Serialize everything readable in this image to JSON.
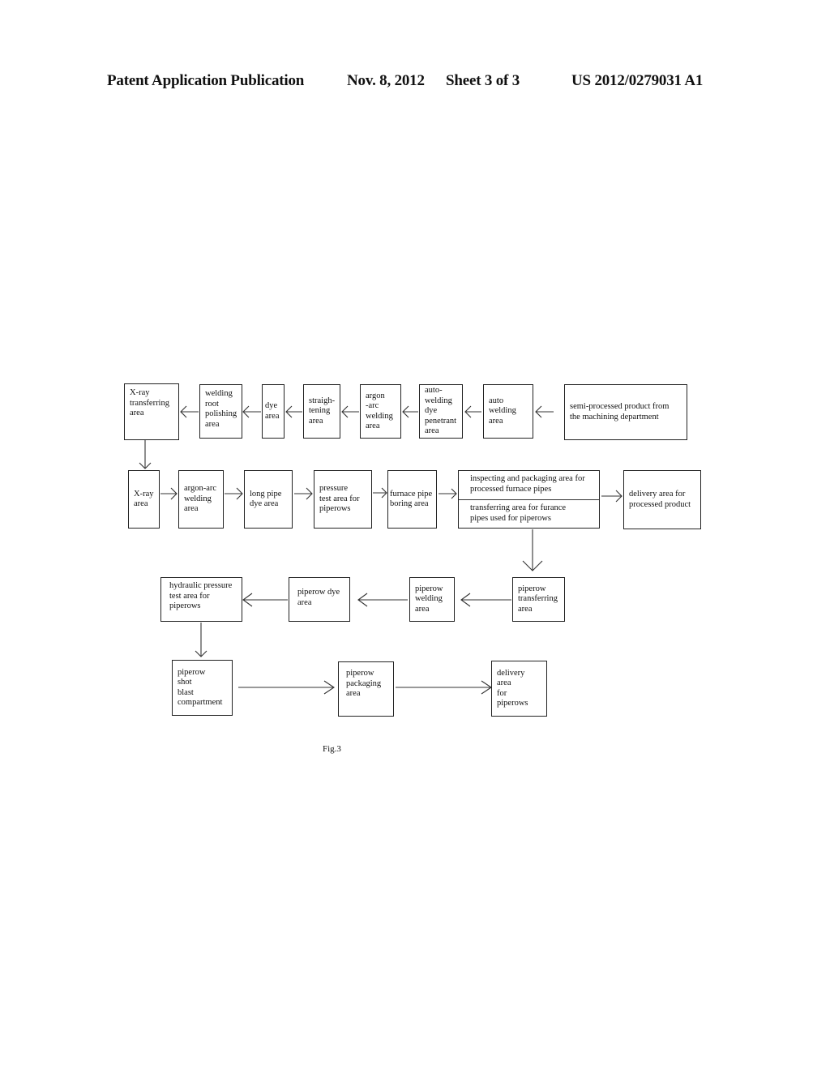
{
  "header": {
    "publication": "Patent Application Publication",
    "date": "Nov. 8, 2012",
    "sheet": "Sheet 3 of 3",
    "number": "US 2012/0279031 A1"
  },
  "figure_label": "Fig.3",
  "row1": [
    {
      "id": "xray-transferring",
      "label": "X-ray\ntransferring\narea"
    },
    {
      "id": "welding-root-polishing",
      "label": "welding\nroot\npolishing\narea"
    },
    {
      "id": "dye",
      "label": "dye\narea"
    },
    {
      "id": "straightening",
      "label": "straigh-\ntening\narea"
    },
    {
      "id": "argon-arc-welding-1",
      "label": "argon\n-arc\nwelding\narea"
    },
    {
      "id": "auto-welding-dye-penetrant",
      "label": "auto-\nwelding\ndye\npenetrant\narea"
    },
    {
      "id": "auto-welding",
      "label": "auto\nwelding\narea"
    },
    {
      "id": "semi-processed",
      "label": "semi-processed product from\nthe machining department"
    }
  ],
  "row2": [
    {
      "id": "xray",
      "label": "X-ray\narea"
    },
    {
      "id": "argon-arc-welding-2",
      "label": "argon-arc\nwelding\narea"
    },
    {
      "id": "long-pipe-dye",
      "label": "long pipe\ndye area"
    },
    {
      "id": "pressure-test",
      "label": "pressure\ntest area for\npiperows"
    },
    {
      "id": "furnace-pipe-boring",
      "label": "furnace pipe\nboring area"
    },
    {
      "id": "inspecting-packaging",
      "label": "inspecting and packaging area for\nprocessed  furnace pipes"
    },
    {
      "id": "transferring-furnace",
      "label": "transferring area for furance\npipes used for piperows"
    },
    {
      "id": "delivery-processed",
      "label": "delivery area for\nprocessed product"
    }
  ],
  "row3": [
    {
      "id": "hydraulic-pressure-test",
      "label": "hydraulic pressure\ntest area for\npiperows"
    },
    {
      "id": "piperow-dye",
      "label": "piperow dye\narea"
    },
    {
      "id": "piperow-welding",
      "label": "piperow\nwelding\narea"
    },
    {
      "id": "piperow-transferring",
      "label": "piperow\ntransferring\narea"
    }
  ],
  "row4": [
    {
      "id": "piperow-shot-blast",
      "label": "piperow\nshot\nblast\ncompartment"
    },
    {
      "id": "piperow-packaging",
      "label": "piperow\npackaging\narea"
    },
    {
      "id": "delivery-piperows",
      "label": "delivery\narea\nfor\npiperows"
    }
  ]
}
